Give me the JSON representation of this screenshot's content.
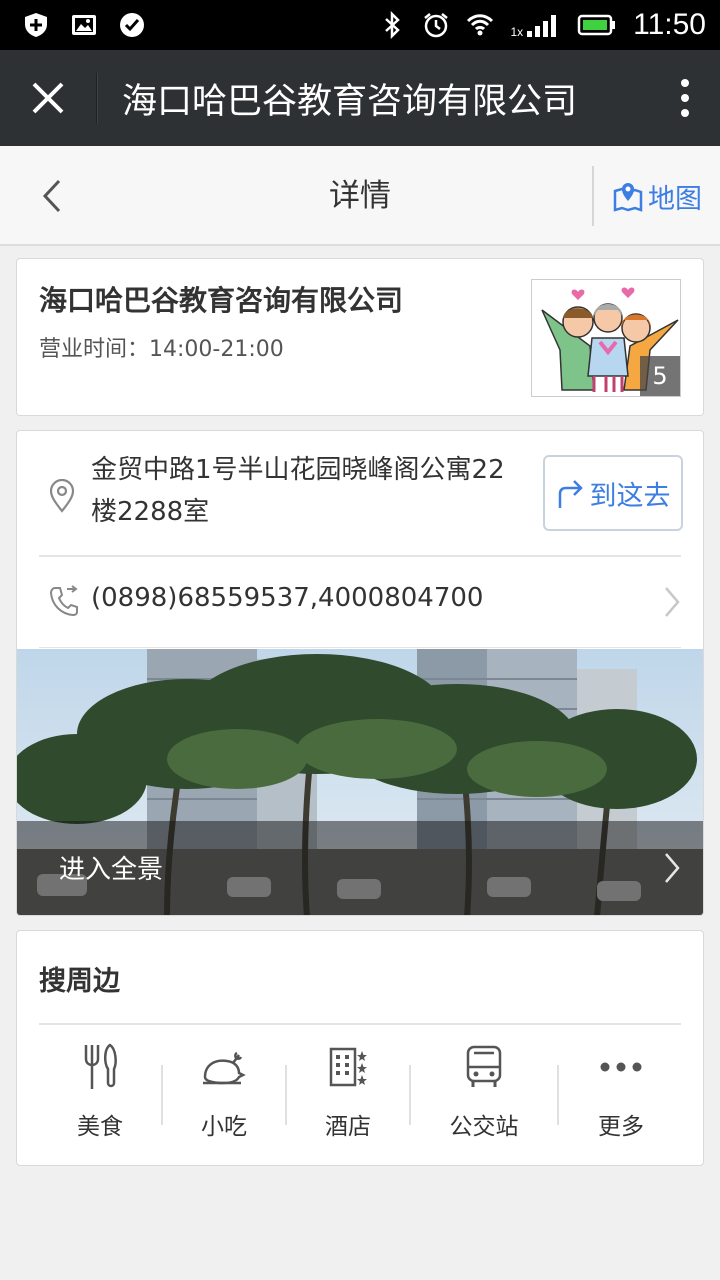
{
  "status_bar": {
    "time": "11:50",
    "network_label": "1x",
    "icons": [
      "shield-icon",
      "image-icon",
      "check-icon",
      "bluetooth-icon",
      "alarm-icon",
      "wifi-icon",
      "signal-icon",
      "battery-icon"
    ]
  },
  "titlebar": {
    "title": "海口哈巴谷教育咨询有限公司",
    "icons": [
      "close-icon",
      "more-vertical-icon"
    ]
  },
  "navbar": {
    "title": "详情",
    "map_label": "地图",
    "icons": [
      "back-chevron-icon",
      "map-pin-icon"
    ]
  },
  "business": {
    "name": "海口哈巴谷教育咨询有限公司",
    "hours": "营业时间：14:00-21:00",
    "photo_count": "5"
  },
  "location": {
    "address": "金贸中路1号半山花园晓峰阁公寓22楼2288室",
    "goto_label": "到这去",
    "phone": "(0898)68559537,4000804700",
    "panorama_label": "进入全景"
  },
  "nearby": {
    "title": "搜周边",
    "items": [
      {
        "label": "美食",
        "icon": "fork-knife-icon"
      },
      {
        "label": "小吃",
        "icon": "roast-chicken-icon"
      },
      {
        "label": "酒店",
        "icon": "hotel-icon"
      },
      {
        "label": "公交站",
        "icon": "bus-icon"
      },
      {
        "label": "更多",
        "icon": "more-dots-icon"
      }
    ]
  },
  "colors": {
    "accent": "#3d7ee3",
    "titlebar": "#2e3133",
    "statusbar": "#000000",
    "background": "#f0f0f0"
  }
}
